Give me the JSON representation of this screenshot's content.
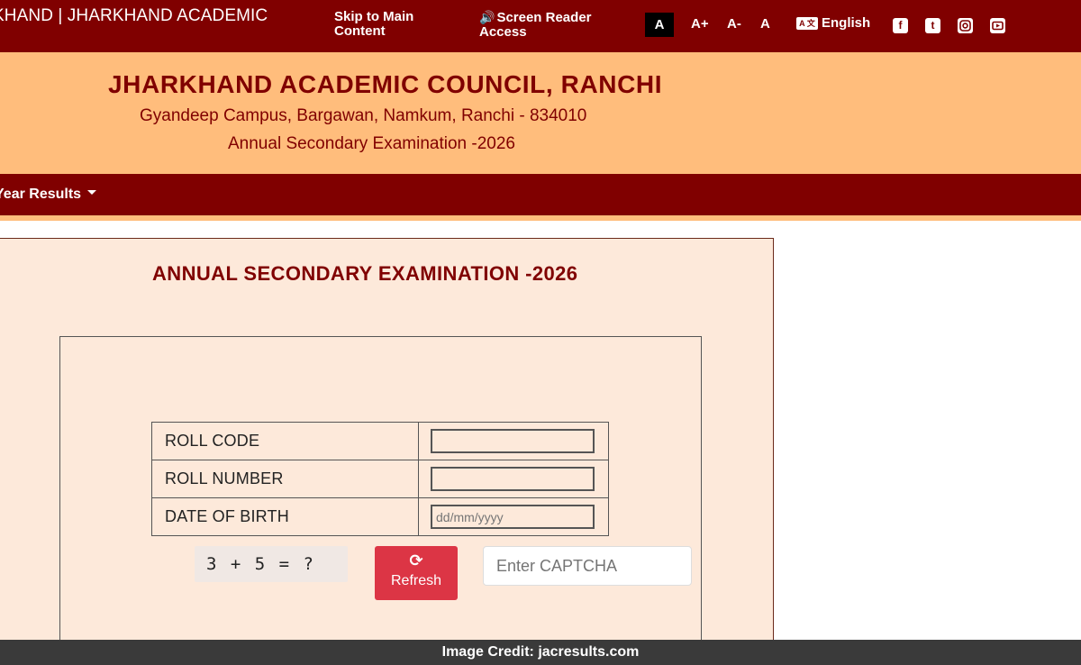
{
  "topbar": {
    "site_name": "KHAND | JHARKHAND ACADEMIC",
    "skip_line1": "Skip to Main",
    "skip_line2": "Content",
    "screen_reader_line1": "Screen Reader",
    "screen_reader_line2": "Access",
    "font_default": "A",
    "font_increase": "A+",
    "font_decrease": "A-",
    "font_reset": "A",
    "language": "English",
    "social": [
      "facebook-icon",
      "twitter-icon",
      "instagram-icon",
      "youtube-icon"
    ]
  },
  "header": {
    "title": "JHARKHAND ACADEMIC COUNCIL, RANCHI",
    "address": "Gyandeep Campus, Bargawan, Namkum, Ranchi - 834010",
    "exam": "Annual Secondary Examination -2026"
  },
  "nav": {
    "results_label": "Year Results"
  },
  "form": {
    "title": "ANNUAL SECONDARY EXAMINATION -2026",
    "roll_code_label": "ROLL CODE",
    "roll_code_value": "",
    "roll_number_label": "ROLL NUMBER",
    "roll_number_value": "",
    "dob_label": "DATE OF BIRTH",
    "dob_placeholder": "dd/mm/yyyy",
    "captcha_question": "3 + 5 = ?",
    "refresh_label": "Refresh",
    "captcha_placeholder": "Enter CAPTCHA"
  },
  "credit": "Image Credit: jacresults.com",
  "colors": {
    "maroon": "#800000",
    "orange": "#ffbd7c",
    "panel_bg": "#fde9da",
    "refresh_red": "#dc3545"
  }
}
